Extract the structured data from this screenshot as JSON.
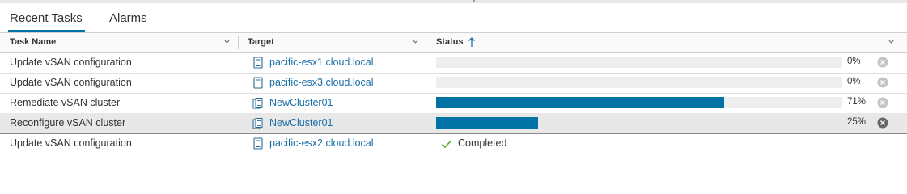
{
  "tabs": [
    {
      "label": "Recent Tasks",
      "active": true
    },
    {
      "label": "Alarms",
      "active": false
    }
  ],
  "columns": [
    {
      "label": "Task Name"
    },
    {
      "label": "Target"
    },
    {
      "label": "Status",
      "sorted": "ascending"
    }
  ],
  "rows": [
    {
      "task": "Update vSAN configuration",
      "target": "pacific-esx1.cloud.local",
      "target_icon": "host-icon",
      "progress": 0,
      "percent": "0%",
      "cancel_disabled": true,
      "selected": false
    },
    {
      "task": "Update vSAN configuration",
      "target": "pacific-esx3.cloud.local",
      "target_icon": "host-icon",
      "progress": 0,
      "percent": "0%",
      "cancel_disabled": true,
      "selected": false
    },
    {
      "task": "Remediate vSAN cluster",
      "target": "NewCluster01",
      "target_icon": "cluster-icon",
      "progress": 71,
      "percent": "71%",
      "cancel_disabled": true,
      "selected": false
    },
    {
      "task": "Reconfigure vSAN cluster",
      "target": "NewCluster01",
      "target_icon": "cluster-icon",
      "progress": 25,
      "percent": "25%",
      "cancel_disabled": false,
      "selected": true
    },
    {
      "task": "Update vSAN configuration",
      "target": "pacific-esx2.cloud.local",
      "target_icon": "host-icon",
      "status": "Completed",
      "status_icon": "check-icon"
    }
  ],
  "colors": {
    "accent": "#0072a3",
    "link": "#1b6fa8",
    "track": "#eeeeee",
    "selected_row": "#e8e8e8",
    "success": "#5aa220"
  }
}
